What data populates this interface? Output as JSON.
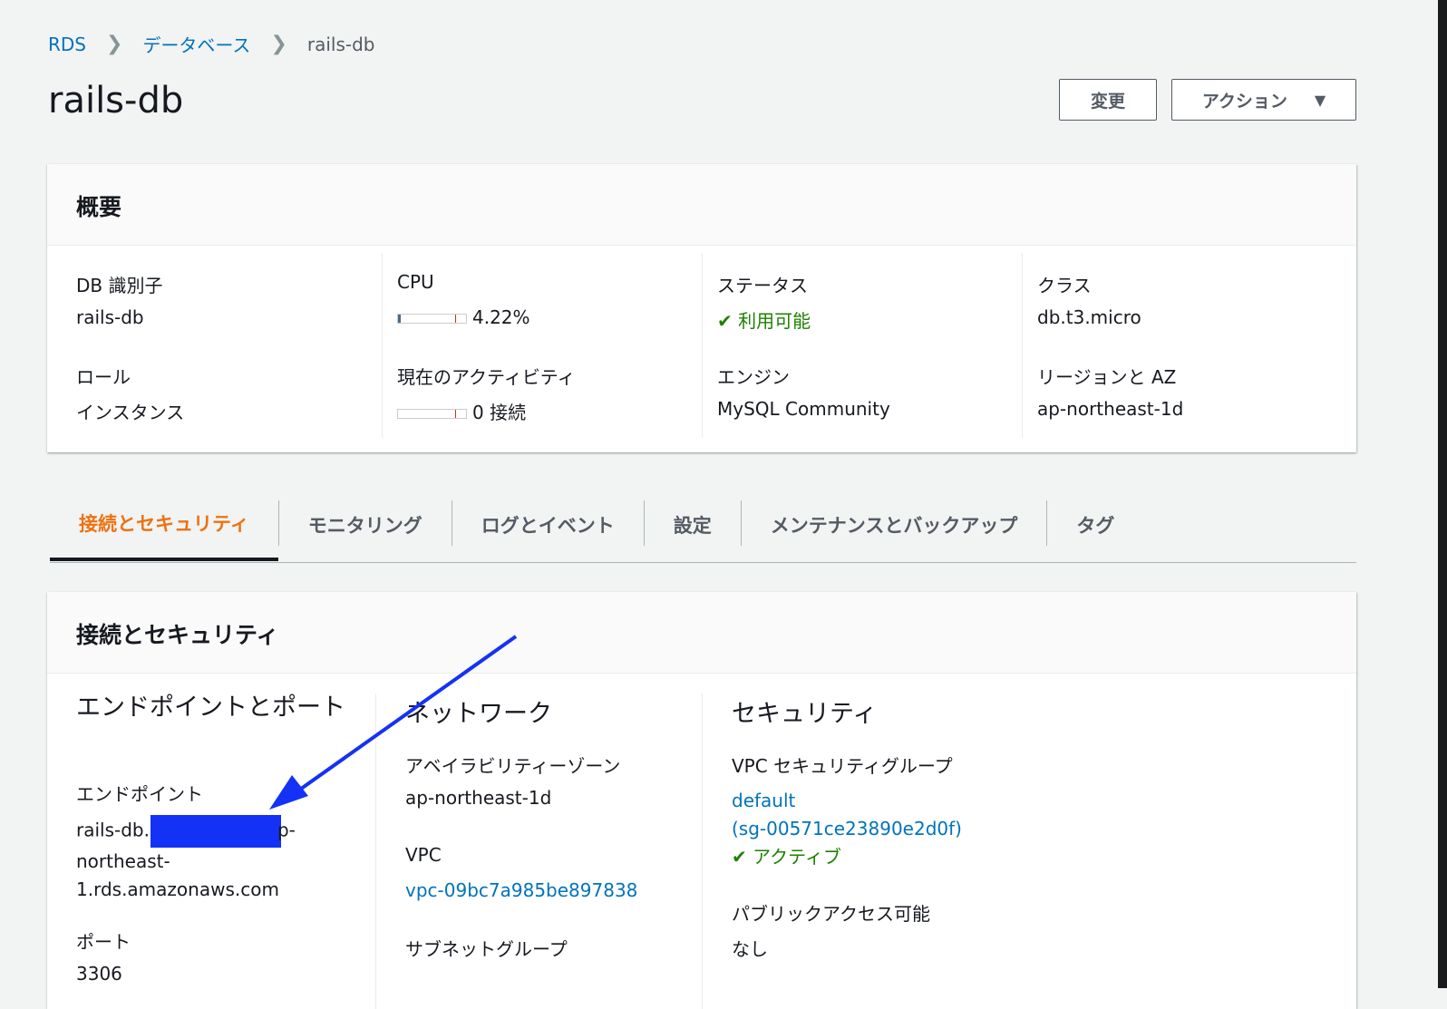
{
  "breadcrumb": [
    "RDS",
    "データベース",
    "rails-db"
  ],
  "title": "rails-db",
  "buttons": {
    "modify": "変更",
    "actions": "アクション"
  },
  "summary": {
    "heading": "概要",
    "db_id_label": "DB 識別子",
    "db_id": "rails-db",
    "role_label": "ロール",
    "role": "インスタンス",
    "cpu_label": "CPU",
    "cpu": "4.22%",
    "cpu_percent": 4.22,
    "activity_label": "現在のアクティビティ",
    "activity": "0 接続",
    "activity_value": 0,
    "status_label": "ステータス",
    "status": "利用可能",
    "engine_label": "エンジン",
    "engine": "MySQL Community",
    "class_label": "クラス",
    "class": "db.t3.micro",
    "region_label": "リージョンと AZ",
    "region": "ap-northeast-1d"
  },
  "tabs": [
    "接続とセキュリティ",
    "モニタリング",
    "ログとイベント",
    "設定",
    "メンテナンスとバックアップ",
    "タグ"
  ],
  "connectivity": {
    "heading": "接続とセキュリティ",
    "endpoint_section": "エンドポイントとポート",
    "endpoint_label": "エンドポイント",
    "endpoint_start": "rails-db.c",
    "endpoint_end": "p-",
    "endpoint_line2": "northeast-",
    "endpoint_line3": "1.rds.amazonaws.com",
    "port_label": "ポート",
    "port": "3306",
    "network_section": "ネットワーク",
    "az_label": "アベイラビリティーゾーン",
    "az": "ap-northeast-1d",
    "vpc_label": "VPC",
    "vpc": "vpc-09bc7a985be897838",
    "subnet_label": "サブネットグループ",
    "security_section": "セキュリティ",
    "sg_label": "VPC セキュリティグループ",
    "sg_name": "default",
    "sg_id": "(sg-00571ce23890e2d0f)",
    "sg_status": "アクティブ",
    "public_label": "パブリックアクセス可能",
    "public": "なし"
  },
  "colors": {
    "link": "#0073bb",
    "ok": "#1d8102",
    "tab_active": "#ec7211",
    "annotation": "#1432f5"
  }
}
